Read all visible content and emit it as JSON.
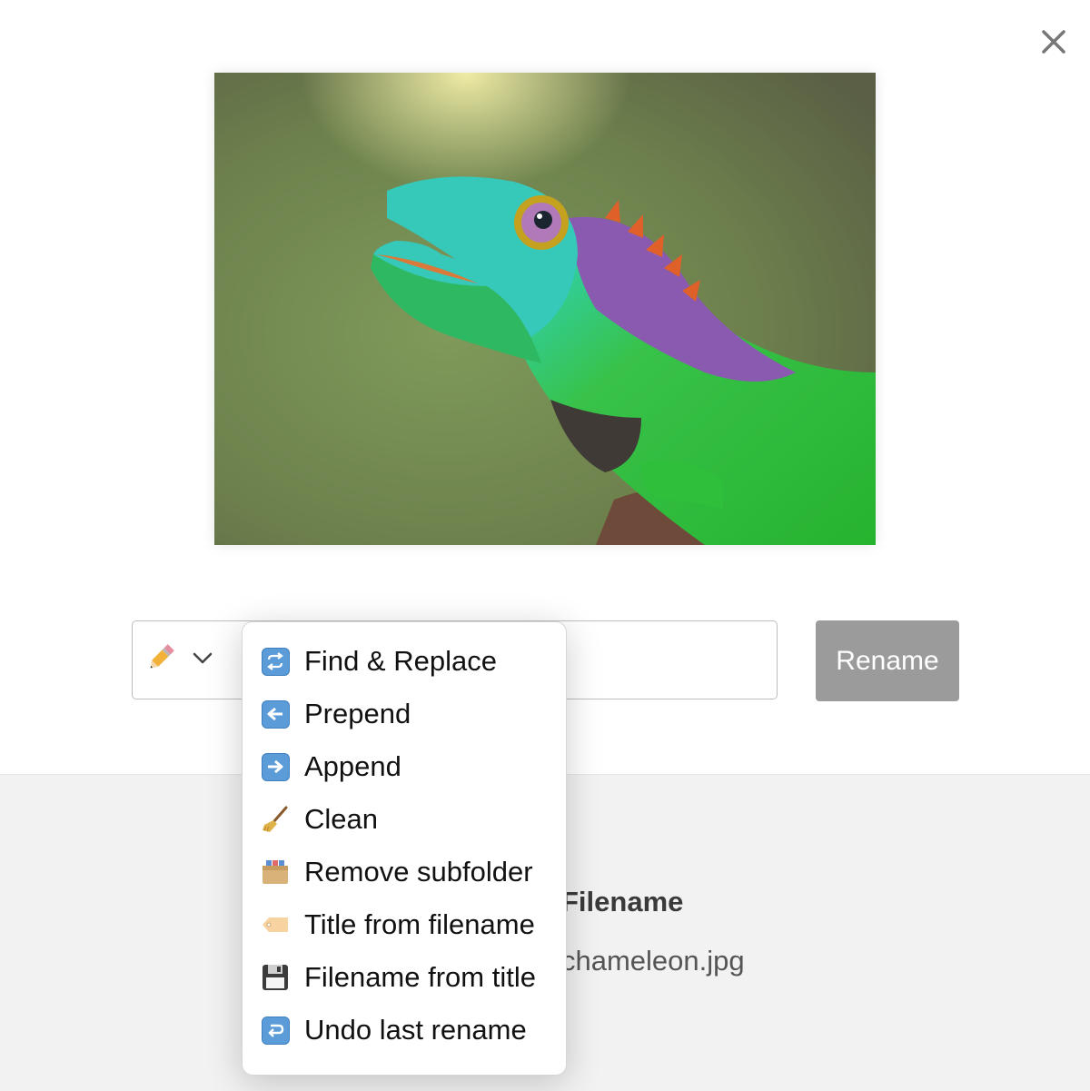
{
  "close": {
    "icon": "close-icon"
  },
  "photo": {
    "icon": "lizard-photo",
    "alt": ""
  },
  "rename_input": {
    "action_icon": "pencil-icon",
    "dropdown_icon": "chevron-down-icon",
    "value": ""
  },
  "rename_button": {
    "label": "Rename",
    "color": "#9b9b9b"
  },
  "file_table": {
    "header": "Filename",
    "row": "chameleon.jpg"
  },
  "menu": {
    "items": [
      {
        "label": "Find & Replace",
        "icon": "repeat-arrows-icon"
      },
      {
        "label": "Prepend",
        "icon": "left-arrow-icon"
      },
      {
        "label": "Append",
        "icon": "right-arrow-icon"
      },
      {
        "label": "Clean",
        "icon": "broom-icon"
      },
      {
        "label": "Remove subfolder",
        "icon": "card-file-box-icon"
      },
      {
        "label": "Title from filename",
        "icon": "label-tag-icon"
      },
      {
        "label": "Filename from title",
        "icon": "floppy-disk-icon"
      },
      {
        "label": "Undo last rename",
        "icon": "return-arrow-icon"
      }
    ]
  }
}
